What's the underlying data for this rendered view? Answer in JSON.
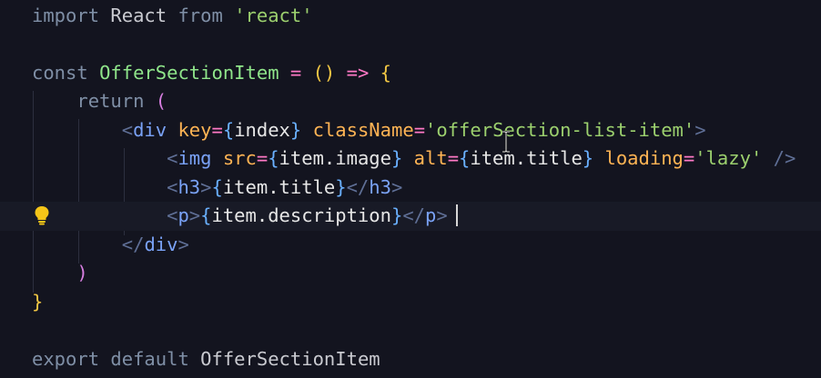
{
  "editor": {
    "lines": [
      [
        {
          "t": "import",
          "c": "c-kw"
        },
        {
          "t": " React ",
          "c": "c-plain"
        },
        {
          "t": "from",
          "c": "c-kw"
        },
        {
          "t": " ",
          "c": "c-plain"
        },
        {
          "t": "'react'",
          "c": "c-str"
        }
      ],
      [],
      [
        {
          "t": "const",
          "c": "c-kw"
        },
        {
          "t": " ",
          "c": "c-plain"
        },
        {
          "t": "OfferSectionItem",
          "c": "c-comp"
        },
        {
          "t": " ",
          "c": "c-plain"
        },
        {
          "t": "=",
          "c": "c-op"
        },
        {
          "t": " ",
          "c": "c-plain"
        },
        {
          "t": "()",
          "c": "c-brace"
        },
        {
          "t": " ",
          "c": "c-plain"
        },
        {
          "t": "=>",
          "c": "c-op"
        },
        {
          "t": " ",
          "c": "c-plain"
        },
        {
          "t": "{",
          "c": "c-brace"
        }
      ],
      [
        {
          "t": "    ",
          "c": "c-plain"
        },
        {
          "t": "return",
          "c": "c-kw"
        },
        {
          "t": " ",
          "c": "c-plain"
        },
        {
          "t": "(",
          "c": "c-brace2"
        }
      ],
      [
        {
          "t": "        ",
          "c": "c-plain"
        },
        {
          "t": "<",
          "c": "c-jsx"
        },
        {
          "t": "div",
          "c": "c-tag"
        },
        {
          "t": " ",
          "c": "c-plain"
        },
        {
          "t": "key",
          "c": "c-attr"
        },
        {
          "t": "=",
          "c": "c-op"
        },
        {
          "t": "{",
          "c": "c-bracket"
        },
        {
          "t": "index",
          "c": "c-expr"
        },
        {
          "t": "}",
          "c": "c-bracket"
        },
        {
          "t": " ",
          "c": "c-plain"
        },
        {
          "t": "className",
          "c": "c-attr"
        },
        {
          "t": "=",
          "c": "c-op"
        },
        {
          "t": "'offerSection-list-item'",
          "c": "c-str"
        },
        {
          "t": ">",
          "c": "c-jsx"
        }
      ],
      [
        {
          "t": "            ",
          "c": "c-plain"
        },
        {
          "t": "<",
          "c": "c-jsx"
        },
        {
          "t": "img",
          "c": "c-tag"
        },
        {
          "t": " ",
          "c": "c-plain"
        },
        {
          "t": "src",
          "c": "c-attr"
        },
        {
          "t": "=",
          "c": "c-op"
        },
        {
          "t": "{",
          "c": "c-bracket"
        },
        {
          "t": "item.image",
          "c": "c-expr"
        },
        {
          "t": "}",
          "c": "c-bracket"
        },
        {
          "t": " ",
          "c": "c-plain"
        },
        {
          "t": "alt",
          "c": "c-attr"
        },
        {
          "t": "=",
          "c": "c-op"
        },
        {
          "t": "{",
          "c": "c-bracket"
        },
        {
          "t": "item.title",
          "c": "c-expr"
        },
        {
          "t": "}",
          "c": "c-bracket"
        },
        {
          "t": " ",
          "c": "c-plain"
        },
        {
          "t": "loading",
          "c": "c-attr"
        },
        {
          "t": "=",
          "c": "c-op"
        },
        {
          "t": "'lazy'",
          "c": "c-str"
        },
        {
          "t": " ",
          "c": "c-plain"
        },
        {
          "t": "/>",
          "c": "c-jsx"
        }
      ],
      [
        {
          "t": "            ",
          "c": "c-plain"
        },
        {
          "t": "<",
          "c": "c-jsx"
        },
        {
          "t": "h3",
          "c": "c-tag"
        },
        {
          "t": ">",
          "c": "c-jsx"
        },
        {
          "t": "{",
          "c": "c-bracket"
        },
        {
          "t": "item.title",
          "c": "c-expr"
        },
        {
          "t": "}",
          "c": "c-bracket"
        },
        {
          "t": "</",
          "c": "c-jsx"
        },
        {
          "t": "h3",
          "c": "c-tag"
        },
        {
          "t": ">",
          "c": "c-jsx"
        }
      ],
      [
        {
          "t": "            ",
          "c": "c-plain"
        },
        {
          "t": "<",
          "c": "c-jsx"
        },
        {
          "t": "p",
          "c": "c-tag"
        },
        {
          "t": ">",
          "c": "c-jsx"
        },
        {
          "t": "{",
          "c": "c-bracket"
        },
        {
          "t": "item.description",
          "c": "c-expr"
        },
        {
          "t": "}",
          "c": "c-bracket"
        },
        {
          "t": "</",
          "c": "c-jsx"
        },
        {
          "t": "p",
          "c": "c-tag"
        },
        {
          "t": ">",
          "c": "c-jsx"
        }
      ],
      [
        {
          "t": "        ",
          "c": "c-plain"
        },
        {
          "t": "</",
          "c": "c-jsx"
        },
        {
          "t": "div",
          "c": "c-tag"
        },
        {
          "t": ">",
          "c": "c-jsx"
        }
      ],
      [
        {
          "t": "    ",
          "c": "c-plain"
        },
        {
          "t": ")",
          "c": "c-brace2"
        }
      ],
      [
        {
          "t": "}",
          "c": "c-brace"
        }
      ],
      [],
      [
        {
          "t": "export",
          "c": "c-kw"
        },
        {
          "t": " ",
          "c": "c-plain"
        },
        {
          "t": "default",
          "c": "c-kw"
        },
        {
          "t": " OfferSectionItem",
          "c": "c-plain"
        }
      ]
    ],
    "current_line_index": 7,
    "lightbulb_icon": "lightbulb-icon",
    "text_cursor_icon": "text-cursor-icon",
    "colors": {
      "background": "#13141f",
      "current_line": "#181a26",
      "keyword": "#7f8fa6",
      "component": "#8fe58a",
      "string": "#9cd06e",
      "tag": "#7aa2f7",
      "attribute": "#ffb454",
      "lightbulb": "#f5c518"
    }
  }
}
